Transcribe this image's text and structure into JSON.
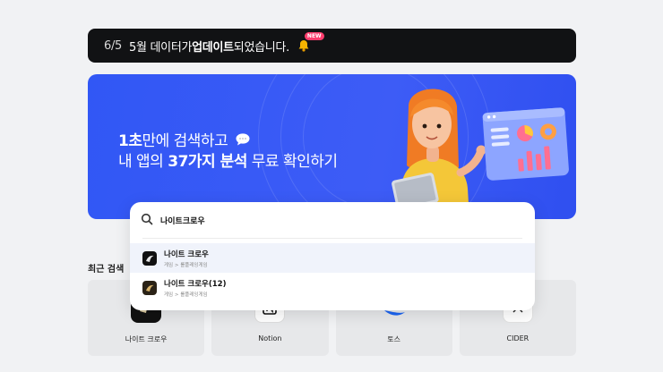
{
  "notice": {
    "date": "6/5",
    "text_before": "5월 데이터가 ",
    "text_bold": "업데이트",
    "text_after": "되었습니다.",
    "badge": "NEW",
    "icon": "bell-icon"
  },
  "banner": {
    "line1_bold": "1초",
    "line1_rest": "만에 검색하고",
    "line2_before": "내 앱의 ",
    "line2_bold": "37가지 분석",
    "line2_after": " 무료 확인하기",
    "accent_color": "#3a5bf6"
  },
  "search": {
    "query": "나이트크로우",
    "results": [
      {
        "title": "나이트 크로우",
        "category": "게임 > 롤플레잉게임"
      },
      {
        "title": "나이트 크로우(12)",
        "category": "게임 > 롤플레잉게임"
      }
    ]
  },
  "recent": {
    "title": "최근 검색",
    "items": [
      {
        "name": "나이트 크로우",
        "icon": "night-crow-app-icon"
      },
      {
        "name": "Notion",
        "icon": "notion-app-icon"
      },
      {
        "name": "토스",
        "icon": "toss-app-icon"
      },
      {
        "name": "CIDER",
        "icon": "cider-app-icon"
      }
    ]
  }
}
